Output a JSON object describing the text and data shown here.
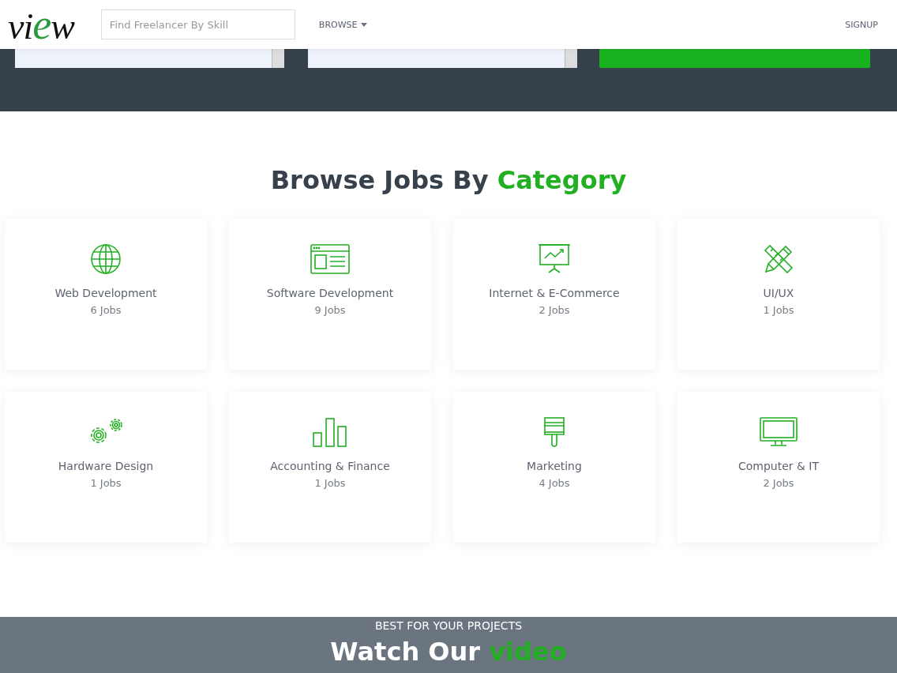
{
  "header": {
    "logo": {
      "before": "vi",
      "accent": "e",
      "after": "w"
    },
    "search": {
      "placeholder": "Find Freelancer By Skill"
    },
    "nav": [
      {
        "label": "BROWSE",
        "dropdown": true
      },
      {
        "label": "SIGNUP",
        "dropdown": false
      }
    ]
  },
  "job_search": {
    "controls": [
      {
        "kind": "select"
      },
      {
        "kind": "select"
      },
      {
        "kind": "button"
      }
    ]
  },
  "categories_section": {
    "title": "Browse Jobs By",
    "title_accent": "Category",
    "items": [
      {
        "kind": "globe",
        "name": "Web Development",
        "count": "6 Jobs"
      },
      {
        "kind": "browser",
        "name": "Software Development",
        "count": "9 Jobs"
      },
      {
        "kind": "presentation",
        "name": "Internet & E-Commerce",
        "count": "2 Jobs"
      },
      {
        "kind": "pencil-ruler",
        "name": "UI/UX",
        "count": "1 Jobs"
      },
      {
        "kind": "gears",
        "name": "Hardware Design",
        "count": "1 Jobs"
      },
      {
        "kind": "bars",
        "name": "Accounting & Finance",
        "count": "1 Jobs"
      },
      {
        "kind": "brush",
        "name": "Marketing",
        "count": "4 Jobs"
      },
      {
        "kind": "monitor",
        "name": "Computer & IT",
        "count": "2 Jobs"
      }
    ]
  },
  "video_section": {
    "eyebrow": "BEST FOR YOUR PROJECTS",
    "title": "Watch Our",
    "title_accent": "video"
  }
}
